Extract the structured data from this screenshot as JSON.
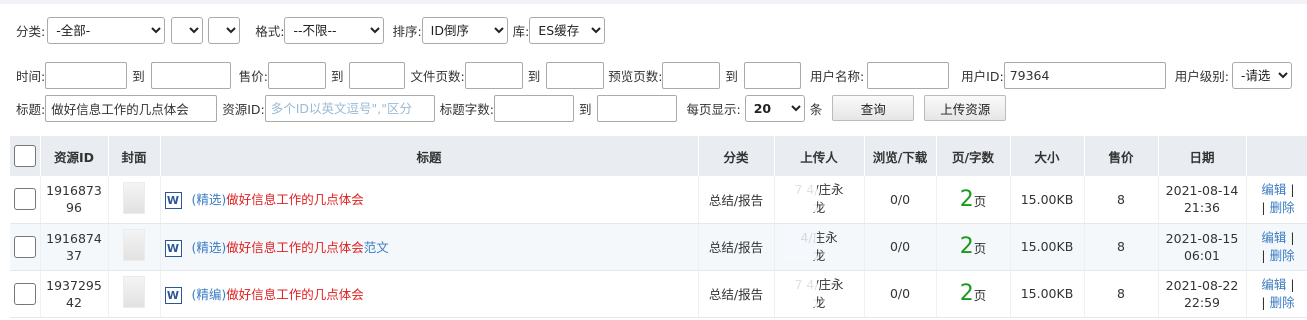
{
  "filters": {
    "category_label": "分类:",
    "category_value": "-全部-",
    "sub1_value": "",
    "sub2_value": "",
    "format_label": "格式:",
    "format_value": "--不限--",
    "sort_label": "排序:",
    "sort_value": "ID倒序",
    "lib_label": "库:",
    "lib_value": "ES缓存"
  },
  "row2": {
    "time_label": "时间:",
    "to1": "到",
    "price_label": "售价:",
    "to2": "到",
    "filepages_label": "文件页数:",
    "to3": "到",
    "preview_label": "预览页数:",
    "to4": "到",
    "username_label": "用户名称:",
    "userid_label": "用户ID:",
    "userid_value": "79364",
    "userlevel_label": "用户级别:",
    "userlevel_value": "-请选择"
  },
  "row3": {
    "title_label": "标题:",
    "title_value": "做好信息工作的几点体会",
    "resid_label": "资源ID:",
    "resid_placeholder": "多个ID以英文逗号\",\"区分",
    "titlelen_label": "标题字数:",
    "to": "到",
    "perpage_label": "每页显示:",
    "perpage_value": "20",
    "perpage_unit": "条",
    "query_button": "查询",
    "upload_button": "上传资源"
  },
  "table": {
    "headers": [
      "资源ID",
      "封面",
      "标题",
      "分类",
      "上传人",
      "浏览/下载",
      "页/字数",
      "大小",
      "售价",
      "日期"
    ],
    "rows": [
      {
        "id_line1": "1916873",
        "id_line2": "96",
        "tag": "(精选)",
        "title_red": "做好信息工作的几点体会",
        "title_blue": "",
        "category": "总结/报告",
        "uploader_line1": "7  4/庄永",
        "uploader_line2": "龙",
        "views": "0/0",
        "pages": "2",
        "pages_suffix": "页",
        "size": "15.00KB",
        "price": "8",
        "date": "2021-08-14",
        "time": "21:36",
        "edit": "编辑",
        "delete": "删除"
      },
      {
        "id_line1": "1916874",
        "id_line2": "37",
        "tag": "(精选)",
        "title_red": "做好信息工作的几点体会",
        "title_blue": "范文",
        "category": "总结/报告",
        "uploader_line1": "4/庄永",
        "uploader_line2": "龙",
        "views": "0/0",
        "pages": "2",
        "pages_suffix": "页",
        "size": "15.00KB",
        "price": "8",
        "date": "2021-08-15",
        "time": "06:01",
        "edit": "编辑",
        "delete": "删除"
      },
      {
        "id_line1": "1937295",
        "id_line2": "42",
        "tag": "(精编)",
        "title_red": "做好信息工作的几点体会",
        "title_blue": "",
        "category": "总结/报告",
        "uploader_line1": "7  4/庄永",
        "uploader_line2": "龙",
        "views": "0/0",
        "pages": "2",
        "pages_suffix": "页",
        "size": "15.00KB",
        "price": "8",
        "date": "2021-08-22",
        "time": "22:59",
        "edit": "编辑",
        "delete": "删除"
      }
    ]
  },
  "icons": {
    "word": "W"
  }
}
